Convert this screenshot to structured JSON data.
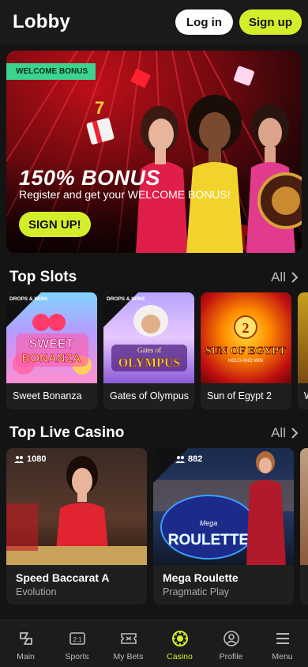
{
  "header": {
    "title": "Lobby",
    "login_label": "Log in",
    "signup_label": "Sign up"
  },
  "hero": {
    "badge": "WELCOME BONUS",
    "title": "150% BONUS",
    "subtitle": "Register and get your WELCOME BONUS!",
    "cta": "SIGN UP!"
  },
  "top_slots": {
    "title": "Top Slots",
    "all_label": "All",
    "games": [
      {
        "name": "Sweet Bonanza",
        "art": "SWEET BONANZA",
        "badge": "DROPS & WINS"
      },
      {
        "name": "Gates of Olympus",
        "art": "Gates of OLYMPUS",
        "badge": "DROPS & WINS"
      },
      {
        "name": "Sun of Egypt 2",
        "art": "SUN OF EGYPT",
        "badge": ""
      },
      {
        "name": "W",
        "art": "",
        "badge": ""
      }
    ]
  },
  "top_live": {
    "title": "Top Live Casino",
    "all_label": "All",
    "games": [
      {
        "name": "Speed Baccarat A",
        "provider": "Evolution",
        "players": "1080"
      },
      {
        "name": "Mega Roulette",
        "provider": "Pragmatic Play",
        "players": "882",
        "art": "MEGA ROULETTE"
      }
    ]
  },
  "nav": {
    "items": [
      {
        "label": "Main",
        "icon": "main-icon"
      },
      {
        "label": "Sports",
        "icon": "sports-icon"
      },
      {
        "label": "My Bets",
        "icon": "ticket-icon"
      },
      {
        "label": "Casino",
        "icon": "casino-chip-icon"
      },
      {
        "label": "Profile",
        "icon": "profile-icon"
      },
      {
        "label": "Menu",
        "icon": "menu-icon"
      }
    ],
    "active_color": "#d4ee2b"
  },
  "colors": {
    "accent": "#d4ee2b",
    "badge_green": "#3bd38e",
    "background": "#141414"
  }
}
